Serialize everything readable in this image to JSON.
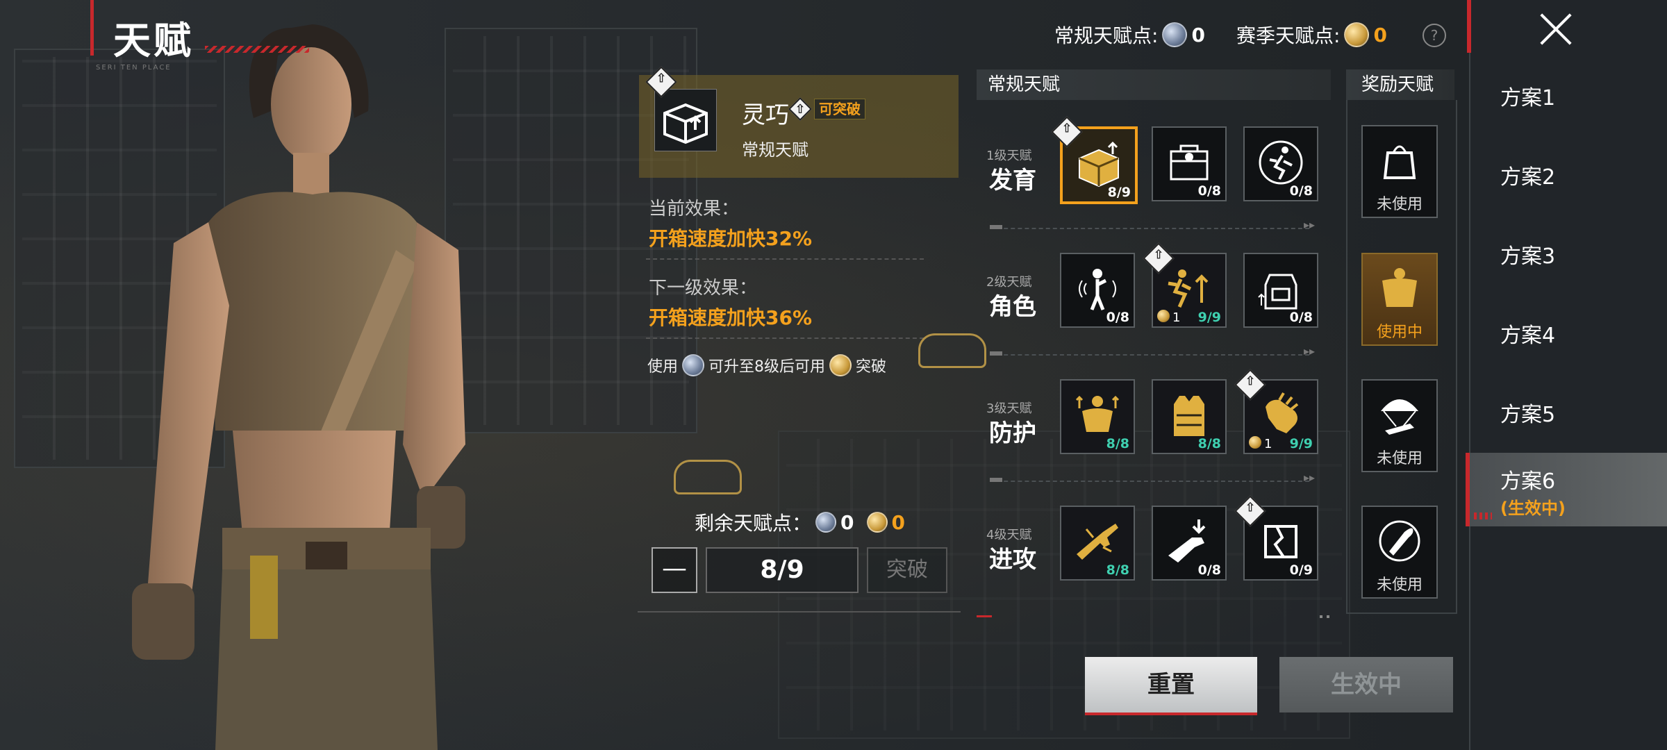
{
  "title": "天赋",
  "title_sub": "SERI TEN PLACE",
  "currency": {
    "regular_label": "常规天赋点:",
    "regular_count": "0",
    "season_label": "赛季天赋点:",
    "season_count": "0"
  },
  "plans": [
    {
      "label": "方案1"
    },
    {
      "label": "方案2"
    },
    {
      "label": "方案3"
    },
    {
      "label": "方案4"
    },
    {
      "label": "方案5"
    },
    {
      "label": "方案6",
      "status": "(生效中)"
    }
  ],
  "detail": {
    "name": "灵巧",
    "tag": "可突破",
    "type": "常规天赋",
    "current_label": "当前效果：",
    "current_effect": "开箱速度加快32%",
    "next_label": "下一级效果：",
    "next_effect": "开箱速度加快36%",
    "usage_pre": "使用",
    "usage_mid": "可升至8级后可用",
    "usage_post": "突破",
    "remaining_label": "剩余天赋点：",
    "remaining_regular": "0",
    "remaining_season": "0",
    "minus_label": "—",
    "level": "8/9",
    "break_label": "突破"
  },
  "sections": {
    "regular": "常规天赋",
    "bonus": "奖励天赋"
  },
  "tiers": [
    {
      "small": "1级天赋",
      "big": "发育",
      "slots": [
        {
          "icon": "lootbox-icon",
          "progress": "8/9",
          "selected": true,
          "upgrade": true
        },
        {
          "icon": "supply-crate-icon",
          "progress": "0/8"
        },
        {
          "icon": "sprinter-icon",
          "progress": "0/8"
        }
      ]
    },
    {
      "small": "2级天赋",
      "big": "角色",
      "slots": [
        {
          "icon": "sound-soldier-icon",
          "progress": "0/8"
        },
        {
          "icon": "running-boost-icon",
          "progress": "9/9",
          "coin": "1",
          "upgrade": true
        },
        {
          "icon": "backpack-icon",
          "progress": "0/8"
        }
      ]
    },
    {
      "small": "3级天赋",
      "big": "防护",
      "slots": [
        {
          "icon": "strength-icon",
          "progress": "8/8"
        },
        {
          "icon": "vest-icon",
          "progress": "8/8"
        },
        {
          "icon": "glove-icon",
          "progress": "9/9",
          "coin": "1",
          "upgrade": true
        }
      ]
    },
    {
      "small": "4级天赋",
      "big": "进攻",
      "slots": [
        {
          "icon": "rifle-icon",
          "progress": "8/8"
        },
        {
          "icon": "weapon-reload-icon",
          "progress": "0/8"
        },
        {
          "icon": "armor-break-icon",
          "progress": "0/9",
          "upgrade": true
        }
      ]
    }
  ],
  "bonus": [
    {
      "icon": "airdrop-bag-icon",
      "label": "未使用"
    },
    {
      "icon": "muscle-icon",
      "label": "使用中",
      "on": true
    },
    {
      "icon": "parachute-gun-icon",
      "label": "未使用"
    },
    {
      "icon": "bullet-icon",
      "label": "未使用"
    }
  ],
  "buttons": {
    "reset": "重置",
    "active": "生效中"
  },
  "colors": {
    "accent_red": "#c8282c",
    "gold": "#f4a11d",
    "teal": "#3fd0b0"
  }
}
